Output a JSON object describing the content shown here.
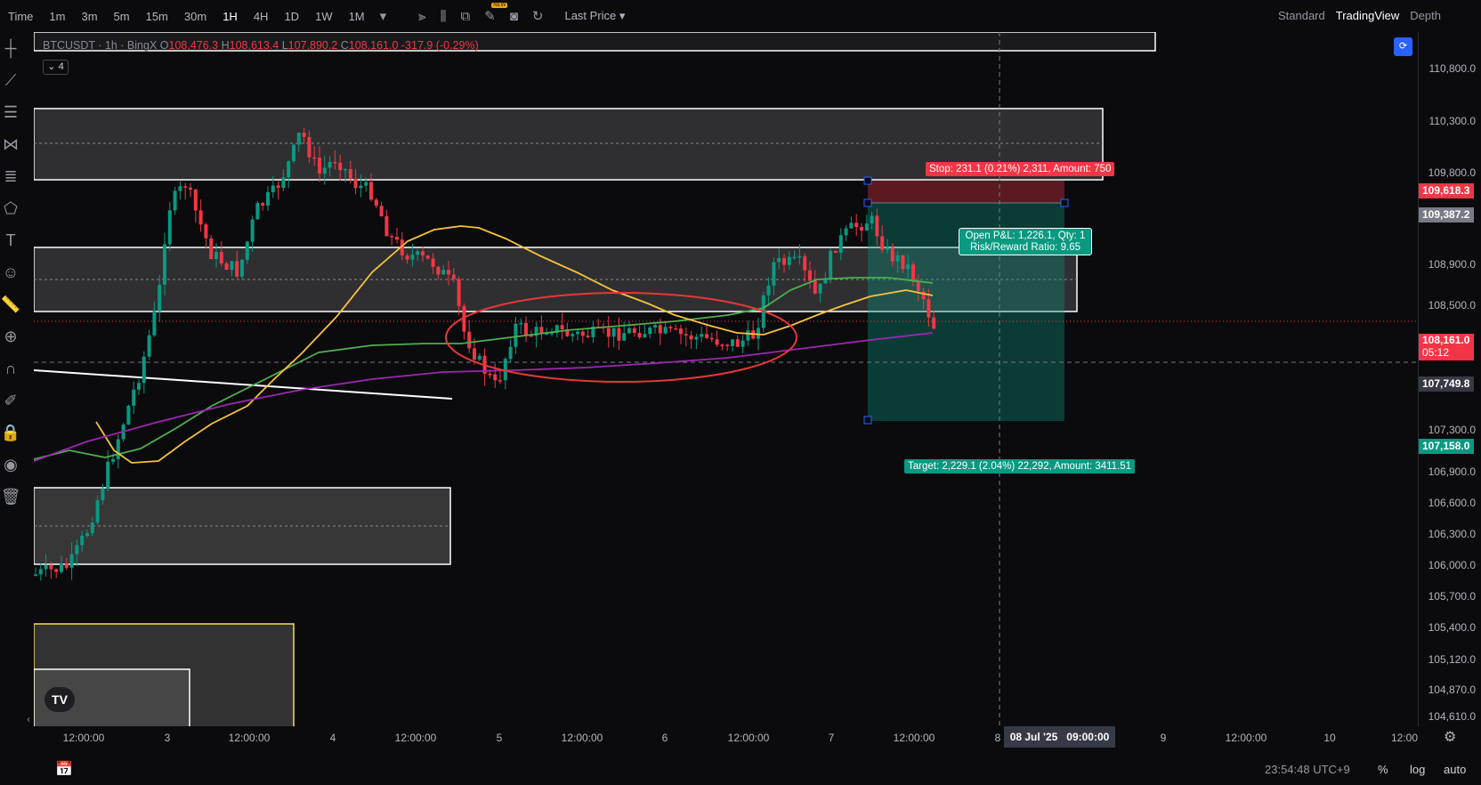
{
  "toolbar": {
    "time_label": "Time",
    "timeframes": [
      "1m",
      "3m",
      "5m",
      "15m",
      "30m",
      "1H",
      "4H",
      "1D",
      "1W",
      "1M"
    ],
    "active_timeframe": "1H",
    "new_badge": "NEW",
    "price_type": "Last Price",
    "view_modes": [
      "Standard",
      "TradingView",
      "Depth"
    ],
    "active_view": "TradingView"
  },
  "legend": {
    "symbol": "BTCUSDT · 1h · BingX",
    "open_label": "O",
    "open": "108,476.3",
    "high_label": "H",
    "high": "108,613.4",
    "low_label": "L",
    "low": "107,890.2",
    "close_label": "C",
    "close": "108,161.0",
    "change": "-317.9 (-0.29%)",
    "indicator_count": "4"
  },
  "position": {
    "stop_label": "Stop: 231.1 (0.21%) 2,311, Amount: 750",
    "pnl_line1": "Open P&L: 1,226.1, Qty: 1",
    "pnl_line2": "Risk/Reward Ratio: 9.65",
    "target_label": "Target: 2,229.1 (2.04%) 22,292, Amount: 3411.51",
    "stop_price": 109618.3,
    "entry_price": 109387.2,
    "target_price": 107158.0
  },
  "price_axis": {
    "ticks": [
      "110,800.0",
      "110,300.0",
      "109,800.0",
      "108,900.0",
      "108,500.0",
      "107,300.0",
      "106,900.0",
      "106,600.0",
      "106,300.0",
      "106,000.0",
      "105,700.0",
      "105,400.0",
      "105,120.0",
      "104,870.0",
      "104,610.0"
    ],
    "tags": {
      "stop": "109,618.3",
      "entry": "109,387.2",
      "current": "108,161.0",
      "countdown": "05:12",
      "crosshair": "107,749.8",
      "target": "107,158.0"
    }
  },
  "time_axis": {
    "labels": [
      "12:00:00",
      "3",
      "12:00:00",
      "4",
      "12:00:00",
      "5",
      "12:00:00",
      "6",
      "12:00:00",
      "7",
      "12:00:00",
      "8",
      "9",
      "12:00:00",
      "10",
      "12:00"
    ],
    "crosshair_date": "08 Jul '25",
    "crosshair_time": "09:00:00"
  },
  "bottom": {
    "clock": "23:54:48 UTC+9",
    "percent": "%",
    "log": "log",
    "auto": "auto"
  },
  "logo": "TV",
  "colors": {
    "background": "#0b0b0d",
    "up": "#089981",
    "down": "#f23645",
    "ma_yellow": "#f7c23b",
    "ma_green": "#4caf50",
    "ma_purple": "#9c27b0",
    "ellipse": "#e53935",
    "accent": "#2962ff"
  }
}
